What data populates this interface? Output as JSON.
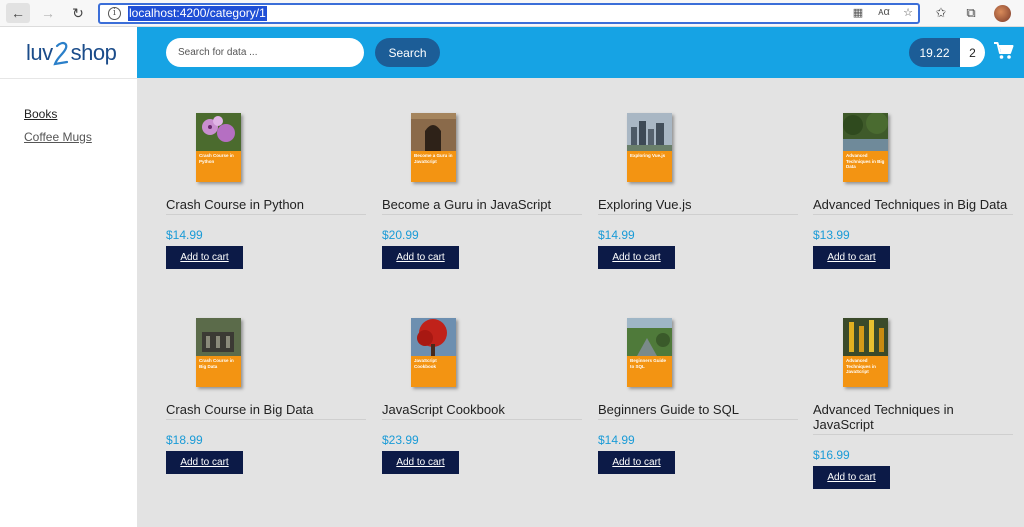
{
  "browser": {
    "url": "localhost:4200/category/1"
  },
  "brand": {
    "logo_left": "luv",
    "logo_right": "shop"
  },
  "sidebar": {
    "categories": [
      {
        "label": "Books"
      },
      {
        "label": "Coffee Mugs"
      }
    ]
  },
  "header": {
    "search_placeholder": "Search for data ...",
    "search_label": "Search",
    "cart_total": "19.22",
    "cart_quantity": "2"
  },
  "colors": {
    "header": "#16a3e4",
    "button_dark": "#1c5d97",
    "cart_button": "#0c1a47",
    "price": "#1a9bd7",
    "book_orange": "#f39412"
  },
  "products": [
    {
      "name": "Crash Course in Python",
      "price": "$14.99",
      "cover_title": "Crash Course in Python",
      "button": "Add to cart"
    },
    {
      "name": "Become a Guru in JavaScript",
      "price": "$20.99",
      "cover_title": "Become a Guru in JavaScript",
      "button": "Add to cart"
    },
    {
      "name": "Exploring Vue.js",
      "price": "$14.99",
      "cover_title": "Exploring Vue.js",
      "button": "Add to cart"
    },
    {
      "name": "Advanced Techniques in Big Data",
      "price": "$13.99",
      "cover_title": "Advanced Techniques in Big Data",
      "button": "Add to cart"
    },
    {
      "name": "Crash Course in Big Data",
      "price": "$18.99",
      "cover_title": "Crash Course in Big Data",
      "button": "Add to cart"
    },
    {
      "name": "JavaScript Cookbook",
      "price": "$23.99",
      "cover_title": "JavaScript Cookbook",
      "button": "Add to cart"
    },
    {
      "name": "Beginners Guide to SQL",
      "price": "$14.99",
      "cover_title": "Beginners Guide to SQL",
      "button": "Add to cart"
    },
    {
      "name": "Advanced Techniques in JavaScript",
      "price": "$16.99",
      "cover_title": "Advanced Techniques in JavaScript",
      "button": "Add to cart"
    }
  ]
}
